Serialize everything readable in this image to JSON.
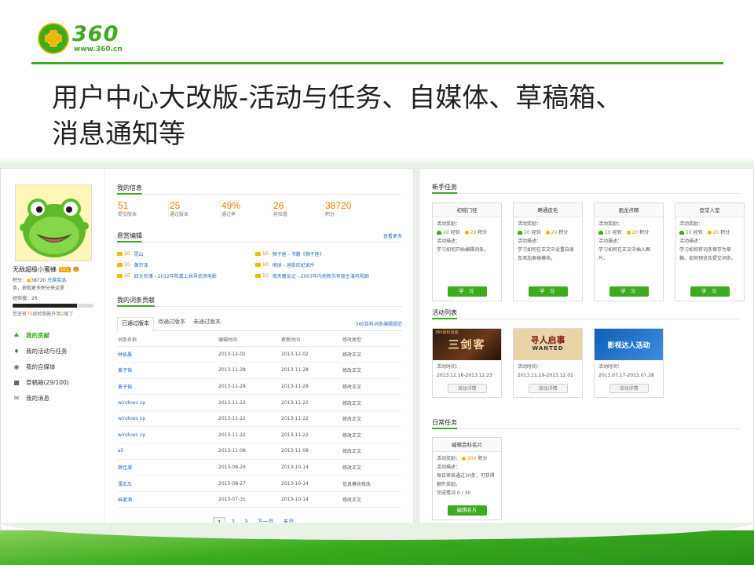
{
  "slide": {
    "logo_text": "360",
    "logo_url": "www.360.cn",
    "title": "用户中心大改版-活动与任务、自媒体、草稿箱、消息通知等"
  },
  "profile": {
    "nickname": "无敌超级小蜜蜂",
    "level": "LV1",
    "points_label": "积分：",
    "points": "38720",
    "exchange": "兑换奖品",
    "tip": "条，获取更多积分来这里",
    "exp_label": "经验值：",
    "exp": "26",
    "exp_progress": 0.8,
    "note_prefix": "您还有",
    "note_highlight": "75",
    "note_mid": "经验就能升到",
    "note_level": "2",
    "note_suffix": "级了"
  },
  "sidebar": {
    "items": [
      {
        "icon": "medal-icon",
        "label": "我的贡献"
      },
      {
        "icon": "diamond-icon",
        "label": "我的活动与任务"
      },
      {
        "icon": "rss-icon",
        "label": "我的自媒体"
      },
      {
        "icon": "briefcase-icon",
        "label": "草稿箱(29/100)"
      },
      {
        "icon": "mail-icon",
        "label": "我的消息"
      }
    ]
  },
  "info": {
    "title": "我的信息",
    "stats": [
      {
        "value": "51",
        "label": "提交版本"
      },
      {
        "value": "25",
        "label": "通过版本"
      },
      {
        "value": "49%",
        "label": "通过率"
      },
      {
        "value": "26",
        "label": "经验值"
      },
      {
        "value": "38720",
        "label": "积分"
      }
    ]
  },
  "bounty": {
    "title": "悬赏编辑",
    "more": "查看更多",
    "items": [
      {
        "points": "10",
        "text": "昆山"
      },
      {
        "points": "10",
        "text": "狮子座 - 书籍《狮子座》"
      },
      {
        "points": "10",
        "text": "黄宗泽"
      },
      {
        "points": "10",
        "text": "地球 - 迪斯尼纪录片"
      },
      {
        "points": "10",
        "text": "四大名捕 - 2012年陈嘉上执导武侠电影"
      },
      {
        "points": "10",
        "text": "倚天屠龙记 - 2003年内地新苏有朋主演电视剧"
      }
    ]
  },
  "contrib": {
    "title": "我的词条贡献",
    "tabs": [
      "已通过版本",
      "待通过版本",
      "未通过版本"
    ],
    "link": "360百科词条编辑规范",
    "headers": [
      "词条名称",
      "编辑时间",
      "更新时间",
      "修改类型"
    ],
    "rows": [
      [
        "林依晨",
        "2013-12-02",
        "2013-12-02",
        "修改正文"
      ],
      [
        "黄子韬",
        "2013-11-28",
        "2013-11-28",
        "修改正文"
      ],
      [
        "黄子韬",
        "2013-11-28",
        "2013-11-28",
        "修改正文"
      ],
      [
        "windows xp",
        "2013-11-22",
        "2013-11-22",
        "修改正文"
      ],
      [
        "windows xp",
        "2013-11-22",
        "2013-11-22",
        "修改正文"
      ],
      [
        "windows xp",
        "2013-11-22",
        "2013-11-22",
        "修改正文"
      ],
      [
        "all",
        "2013-11-08",
        "2013-11-08",
        "修改正文"
      ],
      [
        "薛佳凝",
        "2013-08-29",
        "2013-10-14",
        "修改正文"
      ],
      [
        "薄瓜瓜",
        "2013-08-27",
        "2013-10-14",
        "信息模块修改"
      ],
      [
        "麻婆酒",
        "2013-07-31",
        "2013-10-14",
        "修改正文"
      ]
    ],
    "pager": [
      "1",
      "2",
      "3",
      "下一页",
      "末页"
    ]
  },
  "newbie": {
    "title": "新手任务",
    "reward_label": "活动奖励：",
    "desc_label": "活动描述：",
    "exp_suffix": "经验",
    "coin_suffix": "积分",
    "button": "学 习",
    "cards": [
      {
        "title": "初窥门径",
        "exp": "10",
        "coin": "20",
        "desc": "学习如何开始编辑词条。"
      },
      {
        "title": "略通皮毛",
        "exp": "10",
        "coin": "20",
        "desc": "学习如何在正文中设置自录及添加表格模块。"
      },
      {
        "title": "画龙点睛",
        "exp": "10",
        "coin": "20",
        "desc": "学习如何在正文中插入图片。"
      },
      {
        "title": "登堂入室",
        "exp": "10",
        "coin": "20",
        "desc": "学习如何将词条保存为草稿、如何预览及提交词条。"
      }
    ]
  },
  "activities": {
    "title": "活动列表",
    "time_label": "活动时间：",
    "button": "活动详情",
    "items": [
      {
        "banner": "三剑客",
        "banner_small": "360百科活动",
        "time": "2013.12.16-2013.12.23"
      },
      {
        "banner": "寻人启事",
        "banner_small": "WANTED",
        "time": "2013.11.19-2013.12.01"
      },
      {
        "banner": "影视达人活动",
        "banner_small": "",
        "time": "2013.07.17-2013.07.28"
      }
    ]
  },
  "daily": {
    "title": "日常任务",
    "card_title": "编辑百科名片",
    "reward_label": "活动奖励：",
    "coin": "300",
    "coin_suffix": "积分",
    "desc_label": "活动描述：",
    "desc": "每日审核通过30条，可获得额外奖励。",
    "status_label": "完成情况",
    "status": "0 / 30",
    "button": "编辑名片"
  }
}
